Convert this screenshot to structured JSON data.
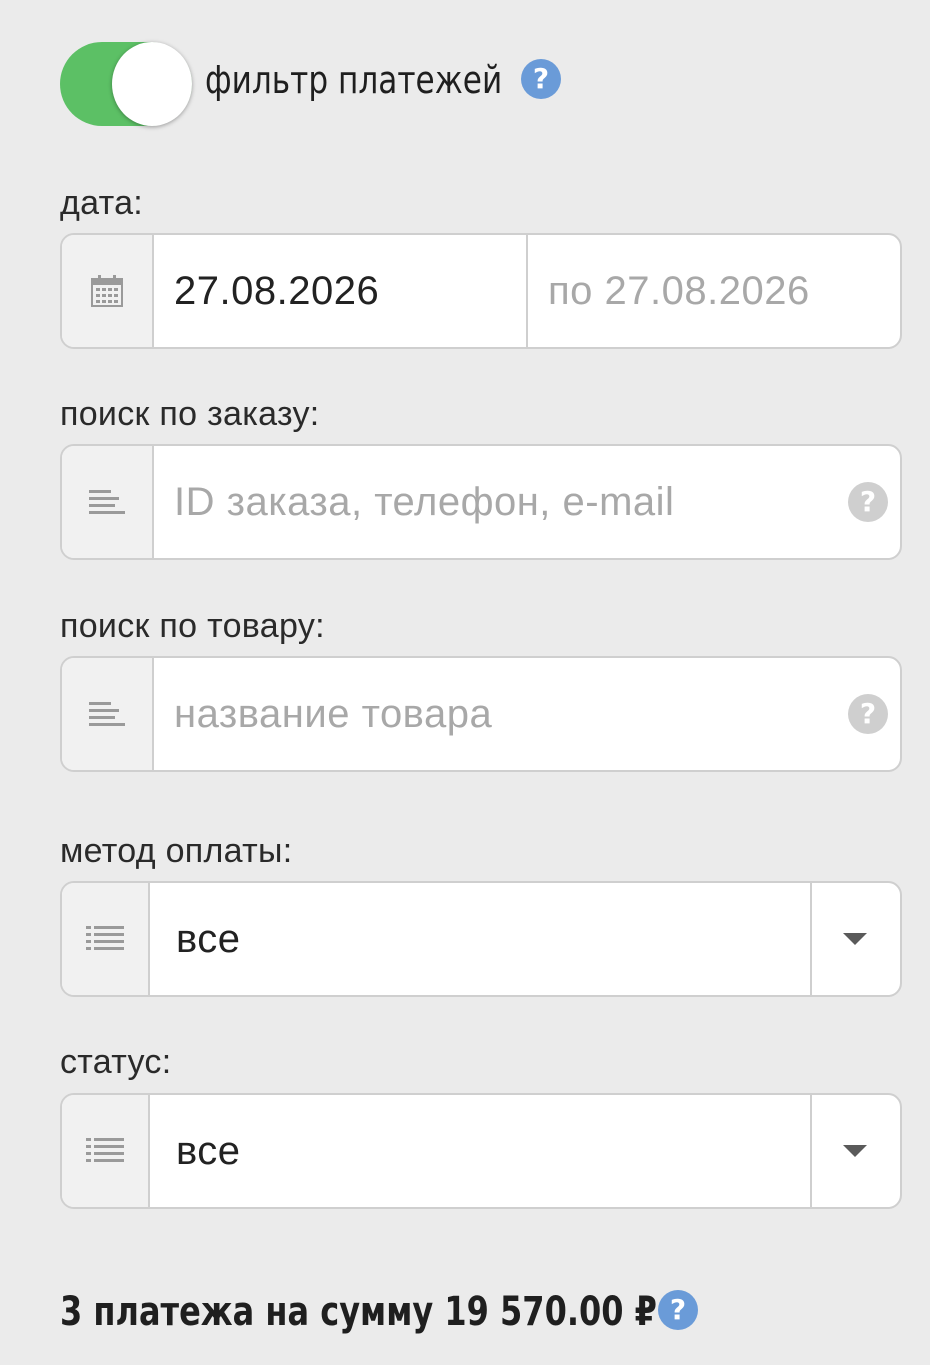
{
  "filter": {
    "enabled": true,
    "title": "фильтр платежей",
    "help_glyph": "?",
    "toggle_color": "#5cc065",
    "help_color": "#6a9bd8"
  },
  "date": {
    "label": "дата:",
    "icon": "calendar-icon",
    "from_value": "27.08.2026",
    "to_placeholder": "по 27.08.2026"
  },
  "order_search": {
    "label": "поиск по заказу:",
    "icon": "text-lines-icon",
    "placeholder": "ID заказа, телефон, e-mail",
    "help_glyph": "?"
  },
  "product_search": {
    "label": "поиск по товару:",
    "icon": "text-lines-icon",
    "placeholder": "название товара",
    "help_glyph": "?"
  },
  "payment_method": {
    "label": "метод оплаты:",
    "icon": "list-icon",
    "selected": "все"
  },
  "status": {
    "label": "статус:",
    "icon": "list-icon",
    "selected": "все"
  },
  "summary": {
    "text": "3 платежа на сумму 19 570.00 ₽",
    "help_glyph": "?"
  }
}
